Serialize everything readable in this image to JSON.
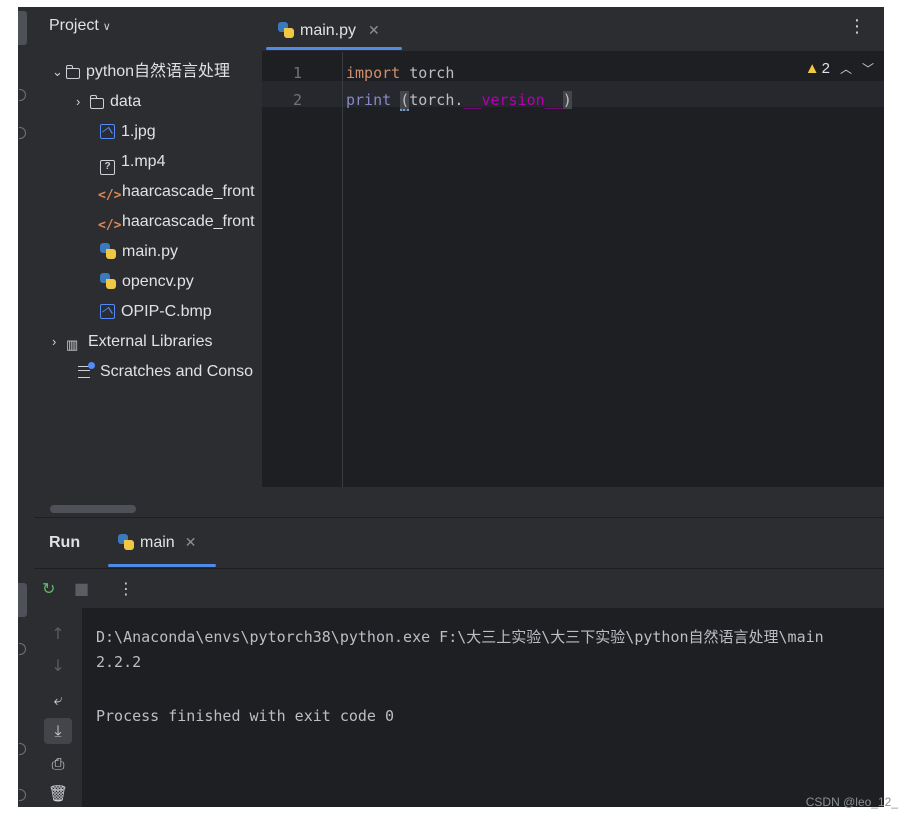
{
  "project_panel": {
    "title": "Project",
    "root": "python自然语言处理",
    "items": [
      {
        "label": "data",
        "icon": "folder-icon"
      },
      {
        "label": "1.jpg",
        "icon": "image-file-icon"
      },
      {
        "label": "1.mp4",
        "icon": "unknown-file-icon"
      },
      {
        "label": "haarcascade_front",
        "icon": "xml-file-icon"
      },
      {
        "label": "haarcascade_front",
        "icon": "xml-file-icon"
      },
      {
        "label": "main.py",
        "icon": "python-file-icon"
      },
      {
        "label": "opencv.py",
        "icon": "python-file-icon"
      },
      {
        "label": "OPIP-C.bmp",
        "icon": "image-file-icon"
      }
    ],
    "external_libraries": "External Libraries",
    "scratches": "Scratches and Conso"
  },
  "editor": {
    "tab_label": "main.py",
    "line_numbers": [
      "1",
      "2"
    ],
    "line1": {
      "keyword": "import",
      "rest": " torch"
    },
    "line2": {
      "fn": "print",
      "open": "(",
      "obj": "torch.",
      "attr": "__version__",
      "close": ")"
    },
    "warnings_count": "2"
  },
  "run_panel": {
    "title": "Run",
    "tab_label": "main",
    "output": [
      "D:\\Anaconda\\envs\\pytorch38\\python.exe F:\\大三上实验\\大三下实验\\python自然语言处理\\main",
      "2.2.2",
      "",
      "Process finished with exit code 0"
    ]
  },
  "watermark": "CSDN @leo_12_",
  "colors": {
    "accent": "#4e8ae8",
    "keyword": "#cf8e6d",
    "dunder": "#b200b2",
    "background": "#1e1f22"
  }
}
